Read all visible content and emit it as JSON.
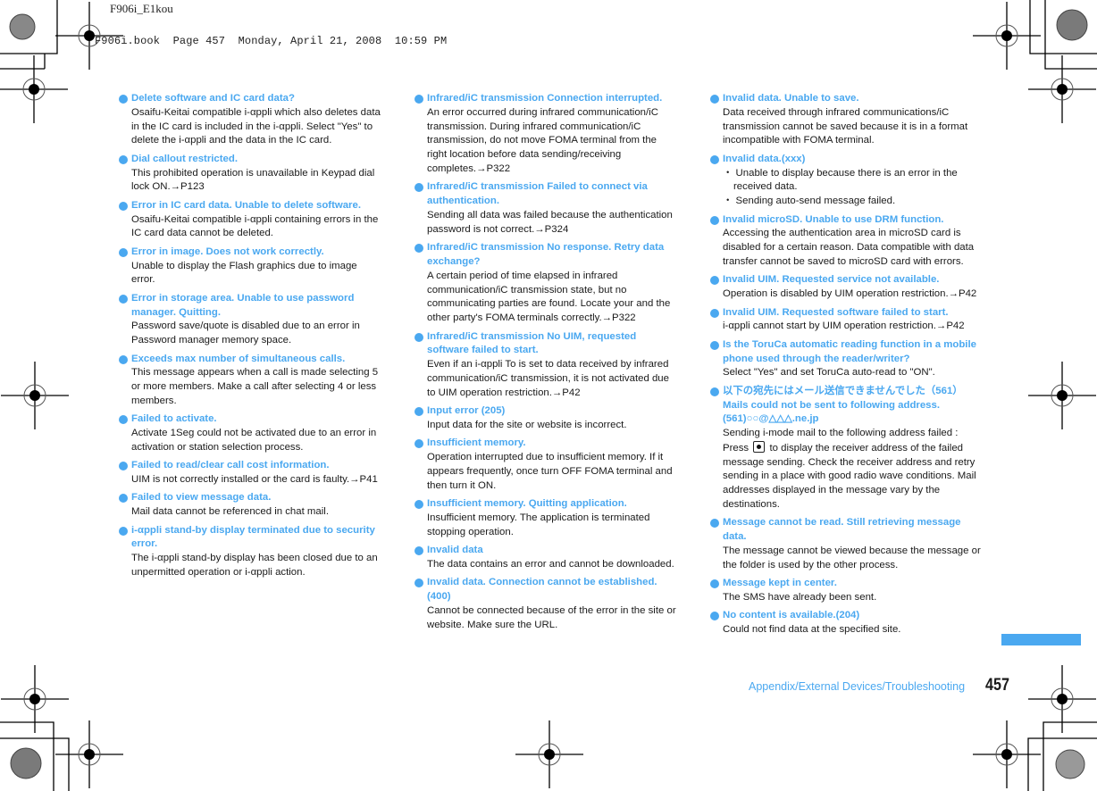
{
  "header": {
    "file_slug": "F906i_E1kou",
    "book_slug": "F906i.book  Page 457  Monday, April 21, 2008  10:59 PM"
  },
  "accent_color": "#4aa8f0",
  "columns": [
    {
      "entries": [
        {
          "title": "Delete software and IC card data?",
          "body": [
            "Osaifu-Keitai compatible i-αppli  which also deletes data in the IC card is included in the i-αppli. Select \"Yes\" to delete the i-αppli and the data in the IC card."
          ]
        },
        {
          "title": "Dial callout restricted.",
          "body": [
            "This prohibited operation is unavailable in Keypad dial lock ON.→P123"
          ]
        },
        {
          "title": "Error in IC card data. Unable to delete software.",
          "body": [
            "Osaifu-Keitai compatible i-αppli containing errors in the IC card data cannot be deleted."
          ]
        },
        {
          "title": "Error in image. Does not work correctly.",
          "body": [
            "Unable to display the Flash graphics due to image error."
          ]
        },
        {
          "title": "Error in storage area. Unable to use password manager. Quitting.",
          "body": [
            "Password save/quote is disabled due to an error in Password manager memory space."
          ]
        },
        {
          "title": "Exceeds max number of simultaneous calls.",
          "body": [
            "This message appears when a call is made selecting 5 or more members. Make a call after selecting 4 or less members."
          ]
        },
        {
          "title": "Failed to activate.",
          "body": [
            "Activate 1Seg could not be activated due to an error in activation or station selection process."
          ]
        },
        {
          "title": "Failed to read/clear call cost information.",
          "body": [
            "UIM is not correctly installed or the card is faulty.→P41"
          ]
        },
        {
          "title": "Failed to view message data.",
          "body": [
            "Mail data cannot be referenced in chat mail."
          ]
        },
        {
          "title": "i-αppli stand-by display terminated due to security error.",
          "body": [
            "The i-αppli stand-by display has been closed due to an unpermitted operation or i-αppli action."
          ]
        }
      ]
    },
    {
      "entries": [
        {
          "title": "Infrared/iC transmission  Connection interrupted.",
          "body": [
            "An error occurred during infrared communication/iC transmission. During infrared communication/iC transmission, do not move FOMA terminal from the right location before data sending/receiving completes.→P322"
          ]
        },
        {
          "title": "Infrared/iC transmission  Failed to connect via authentication.",
          "body": [
            "Sending all data was failed because the authentication password is not correct.→P324"
          ]
        },
        {
          "title": "Infrared/iC transmission  No response. Retry data exchange?",
          "body": [
            "A certain period of time elapsed in infrared communication/iC transmission state, but no communicating parties are found. Locate your and the other party's FOMA terminals correctly.→P322"
          ]
        },
        {
          "title": "Infrared/iC transmission  No UIM, requested software failed to start.",
          "body": [
            "Even if an i-αppli To is set to data received by infrared communication/iC transmission, it is not activated due to UIM operation restriction.→P42"
          ]
        },
        {
          "title": "Input error (205)",
          "body": [
            "Input data for the site or website is incorrect."
          ]
        },
        {
          "title": "Insufficient memory.",
          "body": [
            "Operation interrupted due to insufficient memory. If it appears frequently, once turn OFF FOMA terminal and then turn it ON."
          ]
        },
        {
          "title": "Insufficient memory. Quitting application.",
          "body": [
            "Insufficient memory. The application is terminated stopping operation."
          ]
        },
        {
          "title": "Invalid data",
          "body": [
            "The data contains an error and cannot be downloaded."
          ]
        },
        {
          "title": "Invalid data. Connection cannot be established. (400)",
          "body": [
            "Cannot be connected because of the error in the site or website. Make sure the URL."
          ]
        }
      ]
    },
    {
      "entries": [
        {
          "title": "Invalid data. Unable to save.",
          "body": [
            "Data received through infrared communications/iC transmission cannot be saved because it is in a format incompatible with FOMA terminal."
          ]
        },
        {
          "title": "Invalid data.(xxx)",
          "sub": [
            "・ Unable to display because there is an error in the received data.",
            "・ Sending auto-send message failed."
          ]
        },
        {
          "title": "Invalid microSD. Unable to use DRM function.",
          "body": [
            "Accessing the authentication area in microSD card is disabled for a certain reason. Data compatible with data transfer cannot be saved to microSD card with errors."
          ]
        },
        {
          "title": "Invalid UIM. Requested service not available.",
          "body": [
            "Operation is disabled by UIM operation restriction.→P42"
          ]
        },
        {
          "title": "Invalid UIM. Requested software failed to start.",
          "body": [
            "i-αppli cannot start by UIM operation restriction.→P42"
          ]
        },
        {
          "title": "Is the ToruCa automatic reading function in a mobile phone used through the reader/writer?",
          "body": [
            "Select \"Yes\" and set ToruCa auto-read to \"ON\"."
          ]
        },
        {
          "title": "以下の宛先にはメール送信できませんでした（561） Mails could not be sent to following address.(561)○○@△△△.ne.jp",
          "body_pre": "Sending i-mode mail to the following address failed : Press ",
          "body_key": "center-key",
          "body_post": " to display the receiver address of the failed message sending. Check the receiver address and retry sending in a place with good radio wave conditions. Mail addresses displayed in the message vary by the destinations."
        },
        {
          "title": "Message cannot be read. Still retrieving message data.",
          "body": [
            "The message cannot be viewed because the message or the folder is used by the other process."
          ]
        },
        {
          "title": "Message kept in center.",
          "body": [
            "The SMS have already been sent."
          ]
        },
        {
          "title": "No content is available.(204)",
          "body": [
            "Could not find data at the specified site."
          ]
        }
      ]
    }
  ],
  "footer": {
    "section": "Appendix/External Devices/Troubleshooting",
    "page_number": "457"
  }
}
